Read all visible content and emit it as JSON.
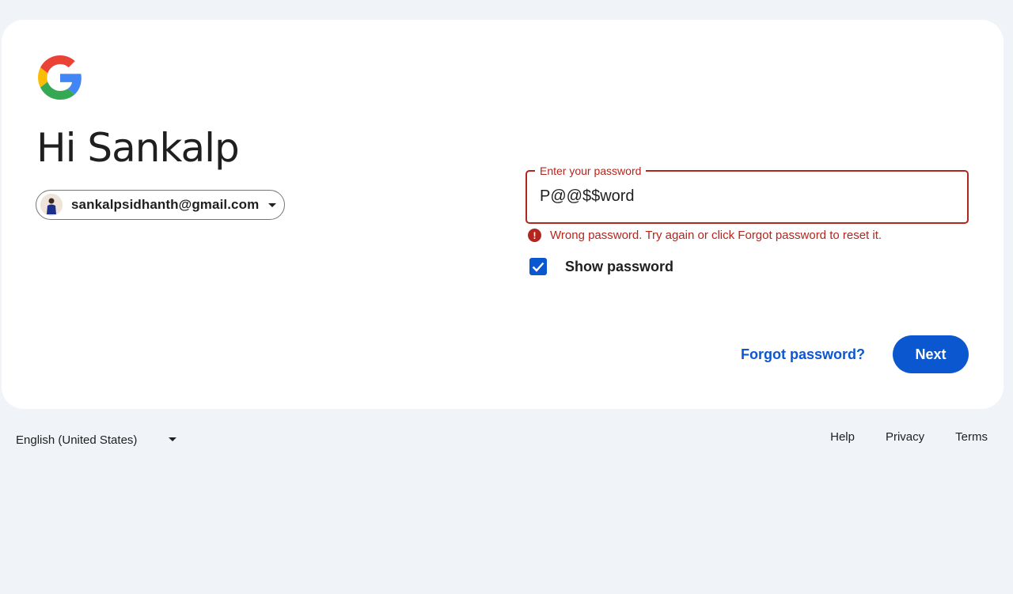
{
  "greeting": "Hi Sankalp",
  "account": {
    "email": "sankalpsidhanth@gmail.com"
  },
  "password": {
    "label": "Enter your password",
    "value": "P@@$$word",
    "error": "Wrong password. Try again or click Forgot password to reset it.",
    "show_password_label": "Show password",
    "show_password_checked": true
  },
  "actions": {
    "forgot_label": "Forgot password?",
    "next_label": "Next"
  },
  "footer": {
    "language": "English (United States)",
    "links": [
      "Help",
      "Privacy",
      "Terms"
    ]
  },
  "colors": {
    "primary": "#0b57d0",
    "error": "#b3261e",
    "background": "#f0f4f9"
  }
}
